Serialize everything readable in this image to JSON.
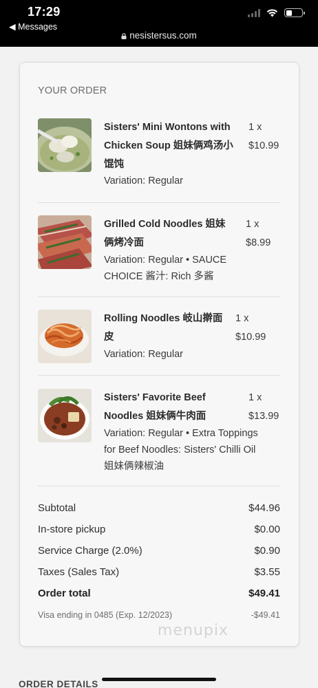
{
  "status_bar": {
    "time": "17:29",
    "back_label": "◀ Messages",
    "url": "nesistersus.com"
  },
  "order": {
    "heading": "YOUR ORDER",
    "items": [
      {
        "name_line1": "Sisters' Mini Wontons with",
        "name_line2": "Chicken Soup 姐妹俩鸡汤小",
        "name_line3": "馄饨",
        "variation_line1": "Variation: Regular",
        "variation_line2": "",
        "variation_line3": "",
        "qty": "1 x",
        "price": "$10.99",
        "image_icon": "wonton-soup-photo"
      },
      {
        "name_line1": "Grilled Cold Noodles 姐妹",
        "name_line2": "俩烤冷面",
        "name_line3": "",
        "variation_line1": "Variation: Regular • SAUCE",
        "variation_line2": "CHOICE 酱汁: Rich 多酱",
        "variation_line3": "",
        "qty": "1 x",
        "price": "$8.99",
        "image_icon": "grilled-cold-noodles-photo"
      },
      {
        "name_line1": "Rolling Noodles 岐山擀面",
        "name_line2": "皮",
        "name_line3": "",
        "variation_line1": "Variation: Regular",
        "variation_line2": "",
        "variation_line3": "",
        "qty": "1 x",
        "price": "$10.99",
        "image_icon": "rolling-noodles-photo"
      },
      {
        "name_line1": "Sisters' Favorite Beef",
        "name_line2": "Noodles 姐妹俩牛肉面",
        "name_line3": "",
        "variation_line1": "Variation: Regular • Extra Toppings",
        "variation_line2": "for Beef Noodles: Sisters' Chilli Oil",
        "variation_line3": "姐妹俩辣椒油",
        "qty": "1 x",
        "price": "$13.99",
        "image_icon": "beef-noodles-photo"
      }
    ],
    "summary": {
      "subtotal_label": "Subtotal",
      "subtotal_value": "$44.96",
      "pickup_label": "In-store pickup",
      "pickup_value": "$0.00",
      "service_label": "Service Charge (2.0%)",
      "service_value": "$0.90",
      "tax_label": "Taxes (Sales Tax)",
      "tax_value": "$3.55",
      "total_label": "Order total",
      "total_value": "$49.41",
      "payment_label": "Visa ending in 0485 (Exp. 12/2023)",
      "payment_value": "-$49.41"
    }
  },
  "watermark": "menupix",
  "next_section_heading": "ORDER DETAILS",
  "colors": {
    "page_bg": "#f2f2f2",
    "card_bg": "#f7f7f7",
    "text": "#2a2a2a",
    "muted": "#6d6d6d"
  }
}
